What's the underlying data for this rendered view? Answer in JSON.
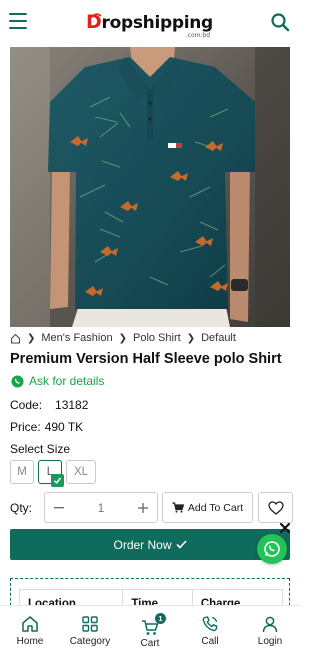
{
  "brand": {
    "logo_text_main": "ropshipping",
    "logo_text_initial": "D",
    "logo_sub": ".com.bd"
  },
  "breadcrumb": {
    "items": [
      "Men's Fashion",
      "Polo Shirt",
      "Default"
    ]
  },
  "product": {
    "title": "Premium Version Half Sleeve polo Shirt",
    "ask_label": "Ask for details",
    "code_label": "Code:",
    "code_value": "13182",
    "price_label": "Price:",
    "price_value": "490 TK",
    "size_label": "Select Size",
    "sizes": [
      "M",
      "L",
      "XL"
    ],
    "selected_size": "L",
    "qty_label": "Qty:",
    "qty_value": "1",
    "add_to_cart_label": "Add To Cart",
    "order_now_label": "Order Now"
  },
  "delivery_table": {
    "headers": [
      "Location",
      "Time",
      "Charge"
    ]
  },
  "bottom_nav": {
    "home": "Home",
    "category": "Category",
    "cart": "Cart",
    "cart_count": "1",
    "call": "Call",
    "login": "Login"
  },
  "colors": {
    "primary": "#0f6b5c",
    "whatsapp": "#25c25a",
    "logo_red": "#e2231a"
  },
  "icons": {
    "menu": "hamburger-menu-icon",
    "search": "search-icon",
    "home": "home-icon",
    "category": "grid-icon",
    "cart": "cart-icon",
    "call": "phone-icon",
    "login": "user-icon",
    "wishlist": "heart-icon",
    "whatsapp": "whatsapp-icon"
  }
}
